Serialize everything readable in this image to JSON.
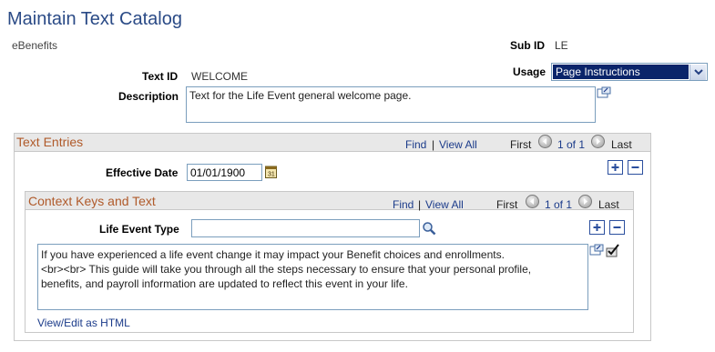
{
  "page": {
    "title": "Maintain Text Catalog",
    "ebenefits": "eBenefits",
    "sub_id_label": "Sub ID",
    "sub_id_value": "LE",
    "text_id_label": "Text ID",
    "text_id_value": "WELCOME",
    "usage_label": "Usage",
    "usage_value": "Page Instructions",
    "description_label": "Description",
    "description_value": "Text for the Life Event general welcome page."
  },
  "text_entries": {
    "title": "Text Entries",
    "find": "Find",
    "sep": "|",
    "view_all": "View All",
    "first": "First",
    "page_info": "1 of 1",
    "last": "Last",
    "effective_date_label": "Effective Date",
    "effective_date_value": "01/01/1900"
  },
  "context_keys": {
    "title": "Context Keys and Text",
    "find": "Find",
    "sep": "|",
    "view_all": "View All",
    "first": "First",
    "page_info": "1 of 1",
    "last": "Last",
    "life_event_label": "Life Event Type",
    "life_event_value": "",
    "text_line1": "If you have experienced a life event change it may impact your Benefit choices and enrollments.",
    "text_line2": "<br><br> This guide will take you through all the steps necessary to ensure that your personal profile,",
    "text_line3": "benefits, and payroll information are updated to reflect this event in your life.",
    "view_edit_html": "View/Edit as HTML"
  },
  "icons": {
    "calendar": "calendar-icon",
    "lookup": "magnifier-icon",
    "expand": "expand-icon",
    "spellcheck": "spellcheck-icon",
    "first": "arrow-left-icon",
    "next": "arrow-right-icon",
    "add": "plus-icon",
    "remove": "minus-icon"
  },
  "colors": {
    "title": "#2a4a86",
    "group_title": "#b05a2a",
    "link": "#1b3b8a",
    "select_highlight": "#0a246a"
  }
}
